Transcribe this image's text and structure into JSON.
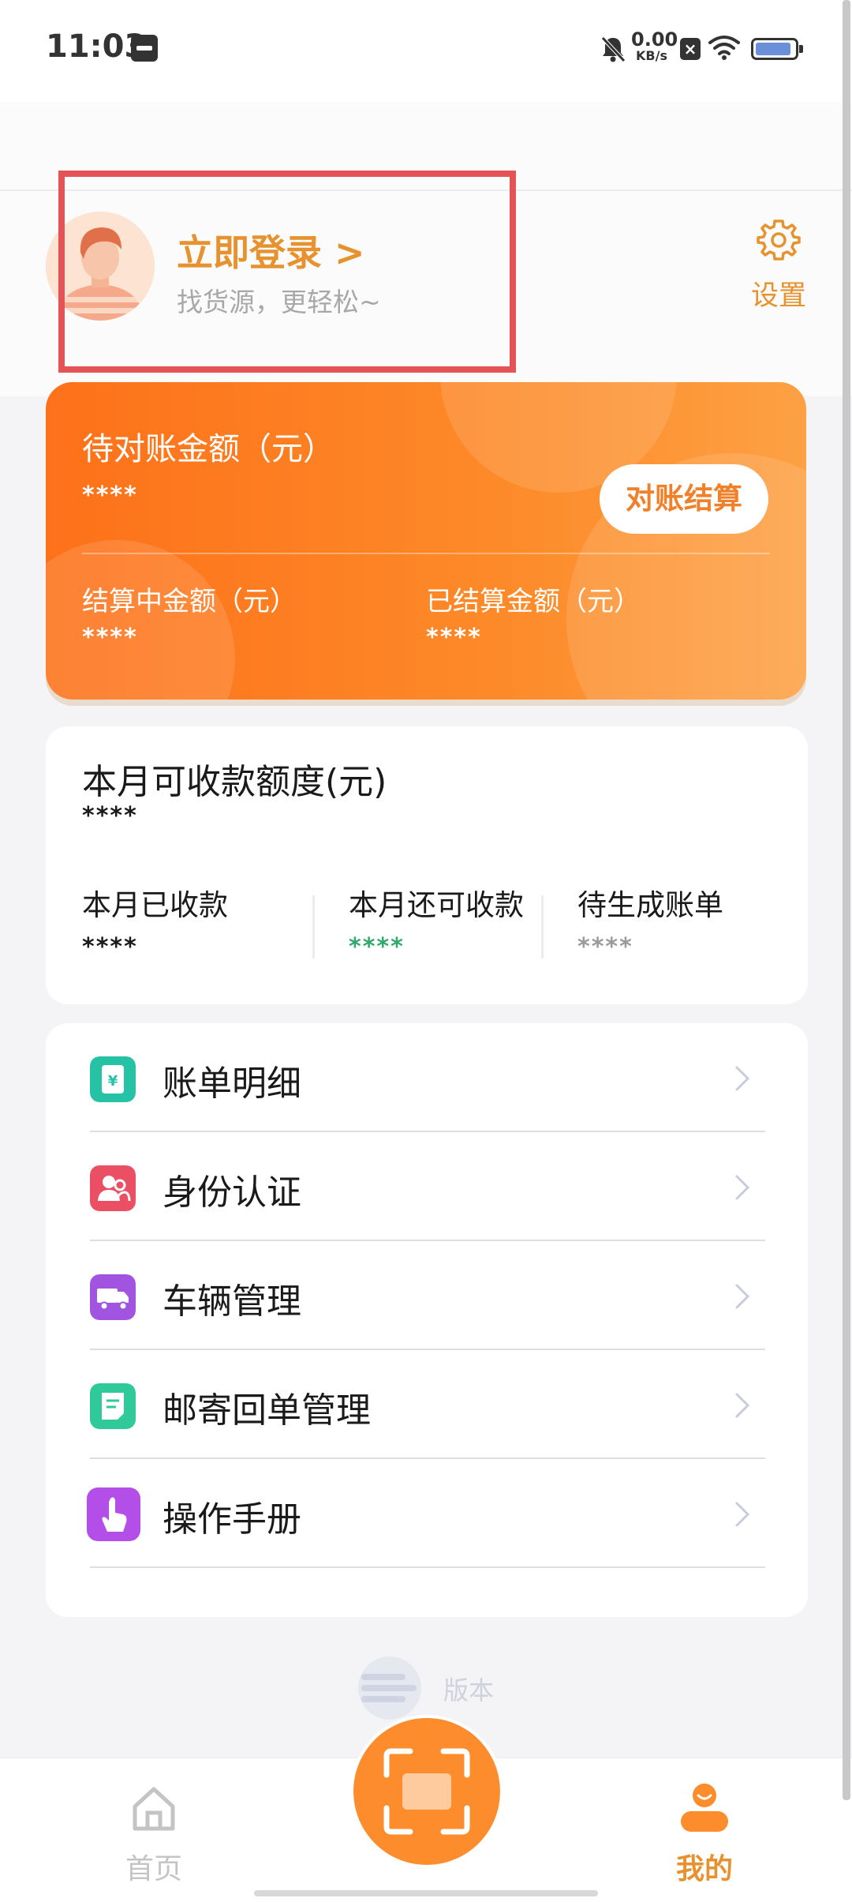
{
  "status_bar": {
    "time": "11:03",
    "net_speed_value": "0.00",
    "net_speed_unit": "KB/s"
  },
  "profile": {
    "login_title": "立即登录 >",
    "login_subtitle": "找货源，更轻松~",
    "settings_label": "设置"
  },
  "settlement_card": {
    "pending_label": "待对账金额（元）",
    "pending_value": "****",
    "reconcile_button": "对账结算",
    "settling_label": "结算中金额（元）",
    "settling_value": "****",
    "settled_label": "已结算金额（元）",
    "settled_value": "****",
    "colors": {
      "gradient_start": "#fd7119",
      "gradient_end": "#fda144"
    }
  },
  "quota_card": {
    "title": "本月可收款额度(元)",
    "value": "****",
    "received_label": "本月已收款",
    "received_value": "****",
    "remaining_label": "本月还可收款",
    "remaining_value": "****",
    "pending_bill_label": "待生成账单",
    "pending_bill_value": "****",
    "colors": {
      "remaining": "#2faa6c",
      "pending_bill": "#9a9a9a"
    }
  },
  "menu": {
    "items": [
      {
        "label": "账单明细",
        "icon": "bill-detail-icon",
        "color": "#26c2a6"
      },
      {
        "label": "身份认证",
        "icon": "identity-icon",
        "color": "#ea4f63"
      },
      {
        "label": "车辆管理",
        "icon": "truck-icon",
        "color": "#a154e0"
      },
      {
        "label": "邮寄回单管理",
        "icon": "receipt-icon",
        "color": "#2fc99a"
      },
      {
        "label": "操作手册",
        "icon": "manual-icon",
        "color": "#b44ee8"
      }
    ]
  },
  "version": {
    "label": "版本"
  },
  "bottom_nav": {
    "home_label": "首页",
    "mine_label": "我的",
    "colors": {
      "active": "#e6922e",
      "inactive": "#c4c4c4",
      "scan": "#fd8c2c"
    }
  }
}
